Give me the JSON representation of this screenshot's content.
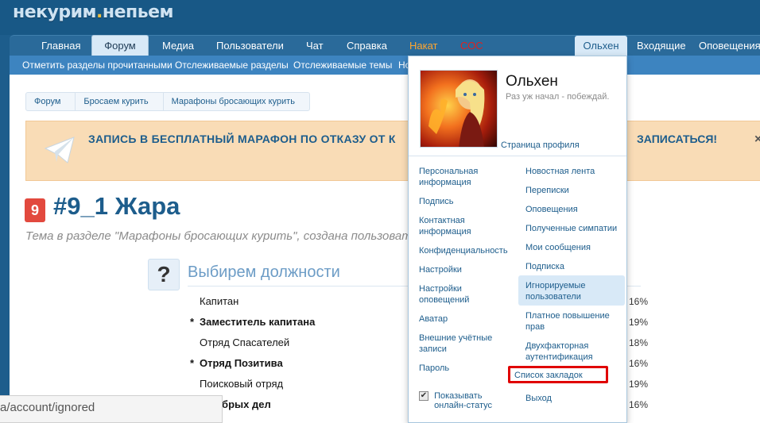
{
  "logo": {
    "text_a": "некурим",
    "dot": ".",
    "text_b": "непьем"
  },
  "nav": [
    {
      "label": "Главная"
    },
    {
      "label": "Форум"
    },
    {
      "label": "Медиа"
    },
    {
      "label": "Пользователи"
    },
    {
      "label": "Чат"
    },
    {
      "label": "Справка"
    },
    {
      "label": "Накат"
    },
    {
      "label": "СОС"
    },
    {
      "label": "Ольхен"
    },
    {
      "label": "Входящие"
    },
    {
      "label": "Оповещения"
    }
  ],
  "subnav": [
    {
      "label": "Отметить разделы прочитанными"
    },
    {
      "label": "Отслеживаемые разделы"
    },
    {
      "label": "Отслеживаемые темы"
    },
    {
      "label": "Но"
    }
  ],
  "breadcrumb": [
    "Форум",
    "Бросаем курить",
    "Марафоны бросающих курить"
  ],
  "notice": {
    "text_left": "ЗАПИСЬ В БЕСПЛАТНЫЙ МАРАФОН ПО ОТКАЗУ ОТ К",
    "text_right": "ЗАПИСАТЬСЯ!",
    "close": "×"
  },
  "thread": {
    "prefix": "9",
    "title": "#9_1 Жара",
    "subtitle": "Тема в разделе \"Марафоны бросающих курить\", создана пользоват"
  },
  "poll": {
    "icon": "?",
    "title": "Выбирем должности",
    "options": [
      {
        "label": "Капитан",
        "voted": false,
        "pct": "16%"
      },
      {
        "label": "Заместитель капитана",
        "voted": true,
        "pct": "19%"
      },
      {
        "label": "Отряд Спасателей",
        "voted": false,
        "pct": "18%"
      },
      {
        "label": "Отряд Позитива",
        "voted": true,
        "pct": "16%"
      },
      {
        "label": "Поисковый отряд",
        "voted": false,
        "pct": "19%"
      },
      {
        "label": "д добрых дел",
        "voted": false,
        "pct": "16%"
      }
    ],
    "star": "*"
  },
  "status_url": "a/account/ignored",
  "dropdown": {
    "name": "Ольхен",
    "status": "Раз уж начал - побеждай.",
    "profile_link": "Страница профиля",
    "left_links": [
      "Персональная информация",
      "Подпись",
      "Контактная информация",
      "Конфиденциальность",
      "Настройки",
      "Настройки оповещений",
      "Аватар",
      "Внешние учётные записи",
      "Пароль"
    ],
    "right_links": [
      "Новостная лента",
      "Переписки",
      "Оповещения",
      "Полученные симпатии",
      "Мои сообщения",
      "Подписка",
      "Игнорируемые пользователи",
      "Платное повышение прав",
      "Двухфакторная аутентификация",
      "Список закладок",
      "Выход"
    ],
    "online_label": "Показывать онлайн-статус",
    "online_checked": true
  },
  "colors": {
    "brand_blue": "#1d5d8c",
    "nav_bg": "#2a6a9a",
    "subnav_bg": "#3d84c0",
    "notice_bg": "#f9dcb6",
    "prefix_red": "#e2493e",
    "highlight_red": "#e00000",
    "nakat_orange": "#ffa630",
    "sos_red": "#e0211f"
  }
}
